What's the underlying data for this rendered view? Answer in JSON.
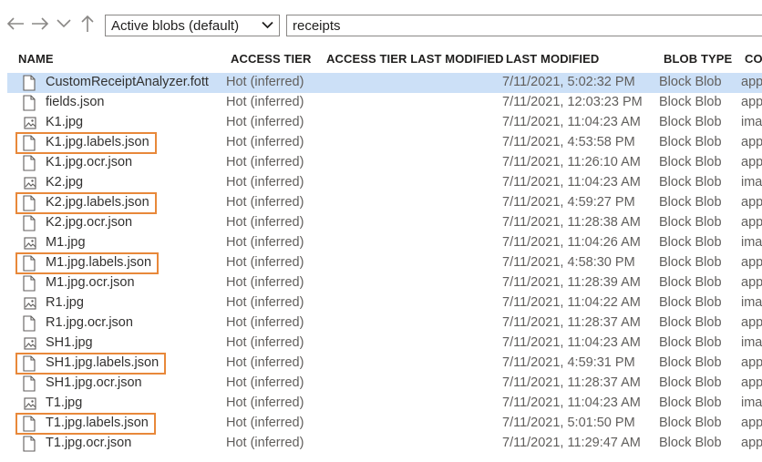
{
  "toolbar": {
    "tier_select_value": "Active blobs (default)",
    "path_value": "receipts"
  },
  "columns": {
    "name": "NAME",
    "access_tier": "ACCESS TIER",
    "access_tier_last_modified": "ACCESS TIER LAST MODIFIED",
    "last_modified": "LAST MODIFIED",
    "blob_type": "BLOB TYPE",
    "content_type": "CO"
  },
  "rows": [
    {
      "name": "CustomReceiptAnalyzer.fott",
      "tier": "Hot (inferred)",
      "modified": "7/11/2021, 5:02:32 PM",
      "type": "Block Blob",
      "ctype": "app",
      "icon": "file-icon",
      "selected": true,
      "highlight": false
    },
    {
      "name": "fields.json",
      "tier": "Hot (inferred)",
      "modified": "7/11/2021, 12:03:23 PM",
      "type": "Block Blob",
      "ctype": "app",
      "icon": "file-icon",
      "selected": false,
      "highlight": false
    },
    {
      "name": "K1.jpg",
      "tier": "Hot (inferred)",
      "modified": "7/11/2021, 11:04:23 AM",
      "type": "Block Blob",
      "ctype": "ima",
      "icon": "image-file-icon",
      "selected": false,
      "highlight": false
    },
    {
      "name": "K1.jpg.labels.json",
      "tier": "Hot (inferred)",
      "modified": "7/11/2021, 4:53:58 PM",
      "type": "Block Blob",
      "ctype": "app",
      "icon": "file-icon",
      "selected": false,
      "highlight": true
    },
    {
      "name": "K1.jpg.ocr.json",
      "tier": "Hot (inferred)",
      "modified": "7/11/2021, 11:26:10 AM",
      "type": "Block Blob",
      "ctype": "app",
      "icon": "file-icon",
      "selected": false,
      "highlight": false
    },
    {
      "name": "K2.jpg",
      "tier": "Hot (inferred)",
      "modified": "7/11/2021, 11:04:23 AM",
      "type": "Block Blob",
      "ctype": "ima",
      "icon": "image-file-icon",
      "selected": false,
      "highlight": false
    },
    {
      "name": "K2.jpg.labels.json",
      "tier": "Hot (inferred)",
      "modified": "7/11/2021, 4:59:27 PM",
      "type": "Block Blob",
      "ctype": "app",
      "icon": "file-icon",
      "selected": false,
      "highlight": true
    },
    {
      "name": "K2.jpg.ocr.json",
      "tier": "Hot (inferred)",
      "modified": "7/11/2021, 11:28:38 AM",
      "type": "Block Blob",
      "ctype": "app",
      "icon": "file-icon",
      "selected": false,
      "highlight": false
    },
    {
      "name": "M1.jpg",
      "tier": "Hot (inferred)",
      "modified": "7/11/2021, 11:04:26 AM",
      "type": "Block Blob",
      "ctype": "ima",
      "icon": "image-file-icon",
      "selected": false,
      "highlight": false
    },
    {
      "name": "M1.jpg.labels.json",
      "tier": "Hot (inferred)",
      "modified": "7/11/2021, 4:58:30 PM",
      "type": "Block Blob",
      "ctype": "app",
      "icon": "file-icon",
      "selected": false,
      "highlight": true
    },
    {
      "name": "M1.jpg.ocr.json",
      "tier": "Hot (inferred)",
      "modified": "7/11/2021, 11:28:39 AM",
      "type": "Block Blob",
      "ctype": "app",
      "icon": "file-icon",
      "selected": false,
      "highlight": false
    },
    {
      "name": "R1.jpg",
      "tier": "Hot (inferred)",
      "modified": "7/11/2021, 11:04:22 AM",
      "type": "Block Blob",
      "ctype": "ima",
      "icon": "image-file-icon",
      "selected": false,
      "highlight": false
    },
    {
      "name": "R1.jpg.ocr.json",
      "tier": "Hot (inferred)",
      "modified": "7/11/2021, 11:28:37 AM",
      "type": "Block Blob",
      "ctype": "app",
      "icon": "file-icon",
      "selected": false,
      "highlight": false
    },
    {
      "name": "SH1.jpg",
      "tier": "Hot (inferred)",
      "modified": "7/11/2021, 11:04:23 AM",
      "type": "Block Blob",
      "ctype": "ima",
      "icon": "image-file-icon",
      "selected": false,
      "highlight": false
    },
    {
      "name": "SH1.jpg.labels.json",
      "tier": "Hot (inferred)",
      "modified": "7/11/2021, 4:59:31 PM",
      "type": "Block Blob",
      "ctype": "app",
      "icon": "file-icon",
      "selected": false,
      "highlight": true
    },
    {
      "name": "SH1.jpg.ocr.json",
      "tier": "Hot (inferred)",
      "modified": "7/11/2021, 11:28:37 AM",
      "type": "Block Blob",
      "ctype": "app",
      "icon": "file-icon",
      "selected": false,
      "highlight": false
    },
    {
      "name": "T1.jpg",
      "tier": "Hot (inferred)",
      "modified": "7/11/2021, 11:04:23 AM",
      "type": "Block Blob",
      "ctype": "ima",
      "icon": "image-file-icon",
      "selected": false,
      "highlight": false
    },
    {
      "name": "T1.jpg.labels.json",
      "tier": "Hot (inferred)",
      "modified": "7/11/2021, 5:01:50 PM",
      "type": "Block Blob",
      "ctype": "app",
      "icon": "file-icon",
      "selected": false,
      "highlight": true
    },
    {
      "name": "T1.jpg.ocr.json",
      "tier": "Hot (inferred)",
      "modified": "7/11/2021, 11:29:47 AM",
      "type": "Block Blob",
      "ctype": "app",
      "icon": "file-icon",
      "selected": false,
      "highlight": false
    }
  ],
  "colors": {
    "selection": "#cce0f7",
    "highlight_box": "#e8883a"
  }
}
